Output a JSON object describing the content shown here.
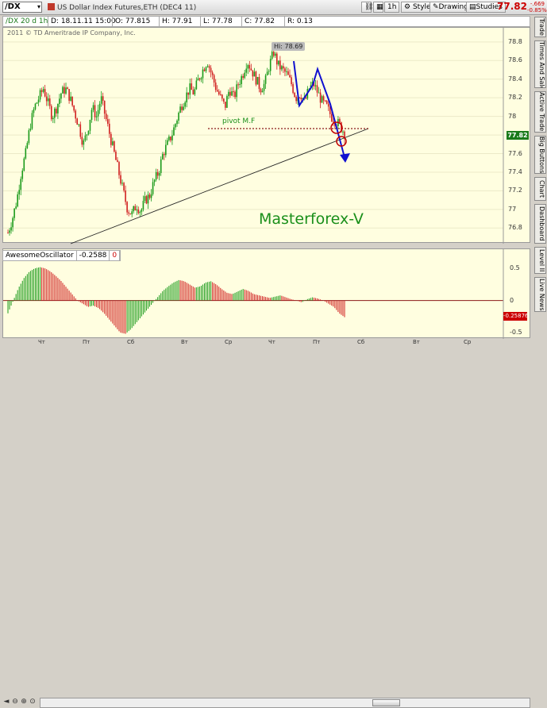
{
  "toolbar": {
    "symbol": "/DX",
    "symbol_dropdown": "▾",
    "chart_title": "US Dollar Index Futures,ETH (DEC4 11)",
    "chart_icon_color": "#c0392b",
    "interval": "1h",
    "style_label": "Style",
    "drawings_label": "Drawings",
    "studies_label": "Studies",
    "last_price": "77.82",
    "change_abs": "-.669",
    "change_pct": "-0.85%"
  },
  "info": {
    "chart_label": "/DX 20 d 1h",
    "date": "D: 18.11.11 15:00",
    "open": "O: 77.815",
    "high": "H: 77.91",
    "low": "L: 77.78",
    "close": "C: 77.82",
    "range": "R: 0.13"
  },
  "main_chart": {
    "copyright": "2011 © TD Ameritrade IP Company, Inc.",
    "high_label": "Hi: 78.69",
    "pivot_label": "pivot M.F",
    "watermark": "Masterforex-V",
    "price_tag": "77.82",
    "y_ticks": [
      "78.8",
      "78.6",
      "78.4",
      "78.2",
      "78",
      "77.8",
      "77.6",
      "77.4",
      "77.2",
      "77",
      "76.8"
    ]
  },
  "oscillator": {
    "name": "AwesomeOscillator",
    "value": "-0.2588",
    "offset": "0",
    "value_tag": "-0.25876",
    "y_ticks": [
      "0.5",
      "0",
      "-0.5"
    ]
  },
  "x_axis": [
    "Чт",
    "Пт",
    "Сб",
    "Вт",
    "Ср",
    "Чт",
    "Пт",
    "Сб",
    "Вт",
    "Ср"
  ],
  "right_tabs": [
    "Trade",
    "Times And Sales",
    "Active Trader",
    "Big Buttons",
    "Chart",
    "Dashboard",
    "Level II",
    "Live News"
  ],
  "colors": {
    "up": "#1a9a1a",
    "down": "#d02020",
    "arrow": "#1010d0",
    "background": "#fffee0",
    "accent_red": "#cc0000"
  },
  "chart_data": {
    "type": "candlestick",
    "y_range": [
      76.7,
      78.85
    ],
    "osc_range": [
      -0.55,
      0.75
    ],
    "price_ticks": [
      78.8,
      78.6,
      78.4,
      78.2,
      78.0,
      77.8,
      77.6,
      77.4,
      77.2,
      77.0,
      76.8
    ],
    "close_path": [
      76.75,
      76.9,
      77.1,
      77.4,
      77.6,
      77.9,
      78.1,
      78.2,
      78.3,
      78.15,
      78.0,
      78.1,
      78.25,
      78.3,
      78.2,
      78.05,
      77.9,
      77.7,
      77.85,
      78.1,
      78.0,
      78.2,
      78.0,
      77.8,
      77.6,
      77.4,
      77.2,
      77.0,
      76.95,
      77.05,
      76.98,
      77.1,
      77.15,
      77.3,
      77.4,
      77.6,
      77.7,
      77.8,
      77.95,
      78.1,
      78.2,
      78.3,
      78.25,
      78.4,
      78.5,
      78.6,
      78.45,
      78.3,
      78.2,
      78.1,
      78.3,
      78.2,
      78.35,
      78.45,
      78.6,
      78.5,
      78.4,
      78.3,
      78.35,
      78.55,
      78.69,
      78.55,
      78.5,
      78.45,
      78.35,
      78.2,
      78.25,
      78.15,
      78.3,
      78.35,
      78.25,
      78.15,
      78.1,
      78.0,
      77.95,
      77.9,
      77.82
    ],
    "osc_path": [
      -0.2,
      0.0,
      0.2,
      0.35,
      0.45,
      0.5,
      0.52,
      0.5,
      0.45,
      0.38,
      0.3,
      0.2,
      0.1,
      0.0,
      -0.05,
      -0.1,
      -0.08,
      -0.12,
      -0.2,
      -0.3,
      -0.4,
      -0.5,
      -0.52,
      -0.45,
      -0.35,
      -0.25,
      -0.15,
      -0.05,
      0.05,
      0.15,
      0.22,
      0.28,
      0.32,
      0.3,
      0.25,
      0.2,
      0.22,
      0.28,
      0.3,
      0.25,
      0.18,
      0.12,
      0.1,
      0.14,
      0.18,
      0.15,
      0.1,
      0.08,
      0.06,
      0.04,
      0.06,
      0.08,
      0.05,
      0.02,
      0.0,
      -0.03,
      0.02,
      0.05,
      0.03,
      0.0,
      -0.05,
      -0.1,
      -0.2,
      -0.26
    ]
  }
}
